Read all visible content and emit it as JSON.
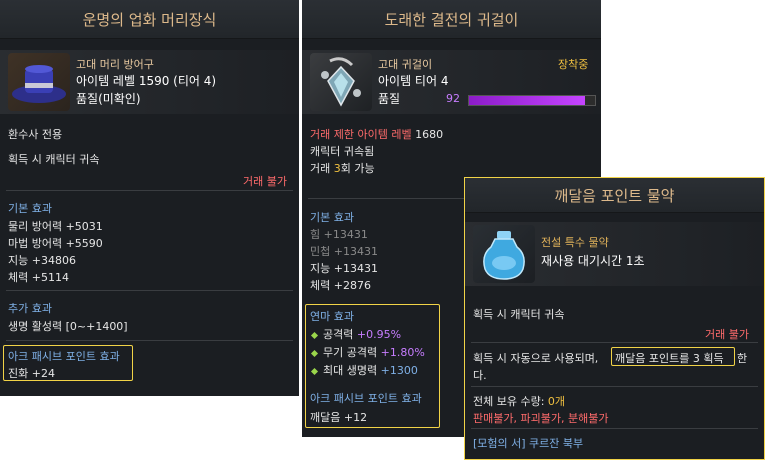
{
  "panel1": {
    "title": "운명의 업화 머리장식",
    "category": "고대 머리 방어구",
    "item_level": "아이템 레벨 1590 (티어 4)",
    "quality": "품질(미확인)",
    "class_restriction": "환수사 전용",
    "bind": "획득 시 캐릭터 귀속",
    "trade": "거래 불가",
    "basic_title": "기본 효과",
    "basic": [
      "물리 방어력 +5031",
      "마법 방어력 +5590",
      "지능 +34806",
      "체력 +5114"
    ],
    "extra_title": "추가 효과",
    "extra": [
      "생명 활성력 [0~+1400]"
    ],
    "ark_title": "아크 패시브 포인트 효과",
    "ark_value": "진화 +24"
  },
  "panel2": {
    "title": "도래한 결전의 귀걸이",
    "category": "고대 귀걸이",
    "equipped": "장착중",
    "tier": "아이템 티어 4",
    "quality_label": "품질",
    "quality_value": "92",
    "quality_fraction": 0.92,
    "req_label": "거래 제한 아이템 레벨",
    "req_value": "1680",
    "bind": "캐릭터 귀속됨",
    "trade_prefix": "거래 ",
    "trade_count": "3",
    "trade_suffix": "회 가능",
    "basic_title": "기본 효과",
    "basic_grey": [
      "힘 +13431",
      "민첩 +13431"
    ],
    "basic": [
      "지능 +13431",
      "체력 +2876"
    ],
    "refine_title": "연마 효과",
    "refine": [
      {
        "name": "공격력",
        "value": "+0.95%"
      },
      {
        "name": "무기 공격력",
        "value": "+1.80%"
      },
      {
        "name": "최대 생명력",
        "value": "+1300"
      }
    ],
    "ark_title": "아크 패시브 포인트 효과",
    "ark_value": "깨달음 +12"
  },
  "panel3": {
    "title": "깨달음 포인트 물약",
    "category": "전설 특수 물약",
    "cooldown": "재사용 대기시간 1초",
    "bind": "획득 시 캐릭터 귀속",
    "trade": "거래 불가",
    "desc_prefix": "획득 시 자동으로 사용되며,",
    "desc_highlight": "깨달음 포인트를 3 획득",
    "desc_suffix1": "한",
    "desc_suffix2": "다.",
    "owned_label": "전체 보유 수량: ",
    "owned_value": "0개",
    "restrictions": [
      "판매불가",
      "파괴불가",
      "분해불가"
    ],
    "source": "[모험의 서] 쿠르잔 북부"
  },
  "colors": {
    "panel_bg": "#1b1e22",
    "title_gold": "#ddb98b",
    "highlight": "#f1d347",
    "section_blue": "#7fb0e6",
    "warning_red": "#ff6b6b",
    "quality_purple": "#c544ff"
  },
  "icons": [
    "blue-hat-icon",
    "earring-icon",
    "potion-icon"
  ]
}
